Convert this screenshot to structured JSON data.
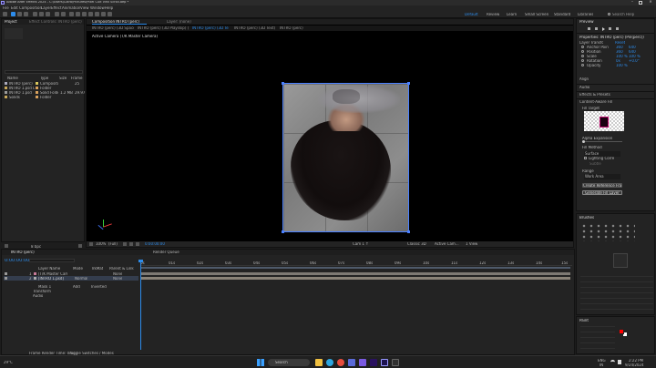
{
  "app": {
    "title": "Adobe After Effects 2024 - C:\\Users\\Clara\\Pictures\\Pixel Cult Vinil Scroll.aep *",
    "menu": [
      "File",
      "Edit",
      "Composition",
      "Layer",
      "Effect",
      "Animation",
      "View",
      "Window",
      "Help"
    ],
    "workspaces": [
      "Default",
      "Review",
      "Learn",
      "Small Screen",
      "Standard",
      "Libraries"
    ],
    "search_placeholder": "Search Help"
  },
  "project_panel": {
    "tabs": [
      "Project",
      "Effect Controls: INTRO (perc)"
    ],
    "columns": [
      "Name",
      "Type",
      "Size",
      "Frame R"
    ],
    "items": [
      {
        "name": "INTRO (perc)",
        "type": "Composition",
        "size": "",
        "fr": "25"
      },
      {
        "name": "INTRO 1.psd Layers",
        "type": "Folder",
        "size": "",
        "fr": ""
      },
      {
        "name": "INTRO 1.psd",
        "type": "Solid Folder",
        "size": "1.2 MB",
        "fr": "29.97"
      },
      {
        "name": "Solids",
        "type": "Folder",
        "size": "",
        "fr": ""
      }
    ],
    "footer": "8 bpc"
  },
  "comp_panel": {
    "tabs": [
      "Composition  INTRO (perc)",
      "INTRO (perc) (3D Space)",
      "INTRO (perc) (3D Playskip) (Layers)",
      "INTRO (perc) (3D Text)",
      "INTRO (perc) (3D Text)",
      "INTRO (perc)"
    ],
    "flowchart_label": "Layer: (none)",
    "view_label": "Active Camera (T/K Master Camera)",
    "footer": {
      "zoom": "100%",
      "quality": "(Full)",
      "timecode": "0:00:00:00",
      "renderer": "Cam 1 ↑",
      "renderer_name": "Classic 3D",
      "camera": "Active Cam...",
      "views": "1 View"
    }
  },
  "properties_panel": {
    "preview_title": "Preview",
    "title": "Properties: INTRO (perc) (Pin(perc))",
    "layer_transform_label": "Layer Transform",
    "reset_label": "Reset",
    "rows": [
      {
        "label": "Anchor Point",
        "v1": "360",
        "v2": "640"
      },
      {
        "label": "Position",
        "v1": "360",
        "v2": "640"
      },
      {
        "label": "Scale",
        "v1": "100 %",
        "v2": "100 %"
      },
      {
        "label": "Rotation",
        "v1": "0x",
        "v2": "+0.0°"
      },
      {
        "label": "Opacity",
        "v1": "100 %",
        "v2": ""
      }
    ],
    "sections": [
      "Align",
      "Audio",
      "Effects & Presets",
      "Content-Aware Fill"
    ],
    "fill_target_label": "Fill Target",
    "alpha_expansion_label": "Alpha Expansion",
    "fill_method_label": "Fill Method",
    "fill_method_value": "Surface",
    "lighting_label": "Lighting Correction",
    "lighting_value": "Subtle",
    "range_label": "Range",
    "range_value": "Work Area",
    "create_ref_btn": "Create Reference Frame",
    "generate_btn": "Generate Fill Layer",
    "brushes_title": "Brushes",
    "paint_title": "Paint",
    "accent": "#2d8ceb",
    "fg_color": "#ff0000",
    "bg_color": "#ffffff"
  },
  "timeline": {
    "tabs": [
      "INTRO (perc)",
      "Render Queue"
    ],
    "timecode": "0:00:00:00",
    "columns": [
      "#",
      "Layer Name",
      "Mode",
      "T",
      "TrkMat",
      "Parent & Link"
    ],
    "layers": [
      {
        "num": "1",
        "name": "[T/K Master Camera]",
        "mode": "",
        "parent": "None"
      },
      {
        "num": "2",
        "name": "[INTRO 1.psd]",
        "mode": "Normal",
        "parent": "None"
      }
    ],
    "sublayers": [
      "Mask 1",
      "Transform",
      "Audio"
    ],
    "mask_mode": "Add",
    "mask_inverted": "Inverted",
    "ruler": [
      "0s",
      "01s",
      "02s",
      "03s",
      "04s",
      "05s",
      "06s",
      "07s",
      "08s",
      "09s",
      "10s",
      "11s",
      "12s",
      "13s",
      "14s",
      "15s"
    ],
    "footer": {
      "frame_render_time": "Frame Render Time:  0ms",
      "toggle": "Toggle Switches / Modes"
    }
  },
  "taskbar": {
    "search_placeholder": "Search",
    "time": "2:22 PM",
    "date": "9/24/2024",
    "lang": "ENG",
    "region": "IN",
    "weather_temp": "29°C"
  }
}
